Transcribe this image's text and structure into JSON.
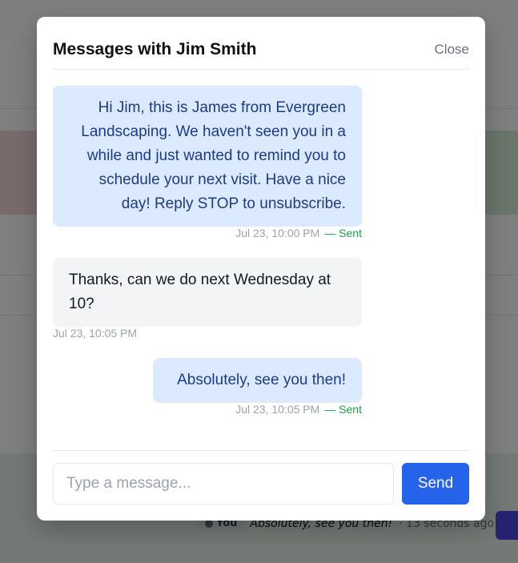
{
  "background": {
    "feed_you": "You",
    "feed_message": "Absolutely, see you then!",
    "feed_time": "· 13 seconds ago"
  },
  "modal": {
    "title": "Messages with Jim Smith",
    "close_label": "Close",
    "messages": [
      {
        "direction": "outgoing",
        "text": "Hi Jim, this is James from Evergreen Landscaping. We haven't seen you in a while and just wanted to remind you to schedule your next visit. Have a nice day! Reply STOP to unsubscribe.",
        "time": "Jul 23, 10:00 PM",
        "status": "— Sent"
      },
      {
        "direction": "incoming",
        "text": "Thanks, can we do next Wednesday at 10?",
        "time": "Jul 23, 10:05 PM"
      },
      {
        "direction": "outgoing",
        "text": "Absolutely, see you then!",
        "time": "Jul 23, 10:05 PM",
        "status": "— Sent"
      }
    ],
    "composer": {
      "placeholder": "Type a message...",
      "value": "",
      "send_label": "Send"
    }
  },
  "colors": {
    "accent": "#2563eb",
    "outgoing_bubble": "#dbeafe",
    "incoming_bubble": "#f3f4f6",
    "sent_status": "#16a34a"
  }
}
